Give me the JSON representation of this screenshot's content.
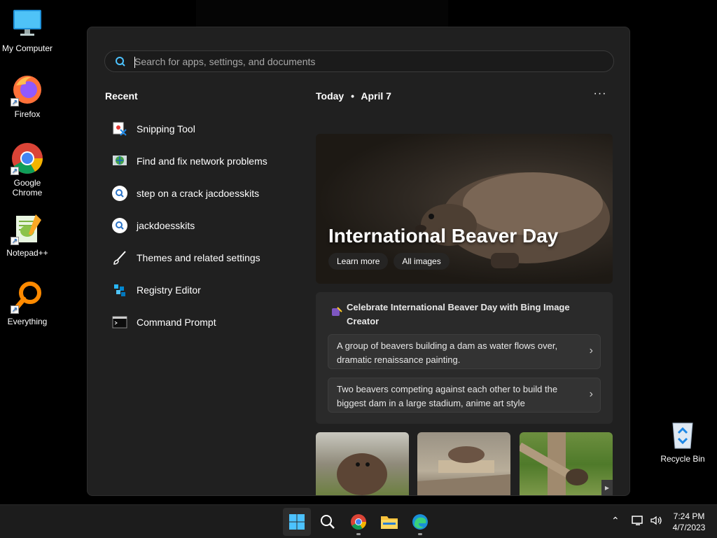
{
  "desktop": {
    "icons": [
      {
        "label": "My Computer",
        "icon": "computer-icon"
      },
      {
        "label": "Firefox",
        "icon": "firefox-icon"
      },
      {
        "label": "Google Chrome",
        "icon": "chrome-icon"
      },
      {
        "label": "Notepad++",
        "icon": "notepadpp-icon"
      },
      {
        "label": "Everything",
        "icon": "everything-icon"
      },
      {
        "label": "Recycle Bin",
        "icon": "recycle-bin-icon"
      }
    ]
  },
  "start_menu": {
    "search": {
      "placeholder": "Search for apps, settings, and documents",
      "value": ""
    },
    "recent": {
      "title": "Recent",
      "items": [
        {
          "label": "Snipping Tool",
          "icon": "snipping-tool-icon"
        },
        {
          "label": "Find and fix network problems",
          "icon": "network-troubleshooter-icon"
        },
        {
          "label": "step on a crack jacdoesskits",
          "icon": "search-history-icon"
        },
        {
          "label": "jackdoesskits",
          "icon": "search-history-icon"
        },
        {
          "label": "Themes and related settings",
          "icon": "brush-icon"
        },
        {
          "label": "Registry Editor",
          "icon": "registry-editor-icon"
        },
        {
          "label": "Command Prompt",
          "icon": "command-prompt-icon"
        }
      ]
    },
    "today": {
      "label": "Today",
      "separator": "•",
      "date": "April 7",
      "more": "···"
    },
    "hero": {
      "title": "International Beaver Day",
      "learn_more": "Learn more",
      "all_images": "All images"
    },
    "bing": {
      "title": "Celebrate International Beaver Day with Bing Image Creator",
      "prompts": [
        "A group of beavers building a dam as water flows over, dramatic renaissance painting.",
        "Two beavers competing against each other to build the biggest dam in a large stadium, anime art style"
      ]
    }
  },
  "taskbar": {
    "apps": [
      "start-icon",
      "search-icon",
      "chrome-icon",
      "file-explorer-icon",
      "edge-icon"
    ],
    "clock": {
      "time": "7:24 PM",
      "date": "4/7/2023"
    }
  },
  "colors": {
    "accent": "#5cb8ff",
    "menu_bg": "#202020",
    "card_bg": "#2a2a2a"
  }
}
